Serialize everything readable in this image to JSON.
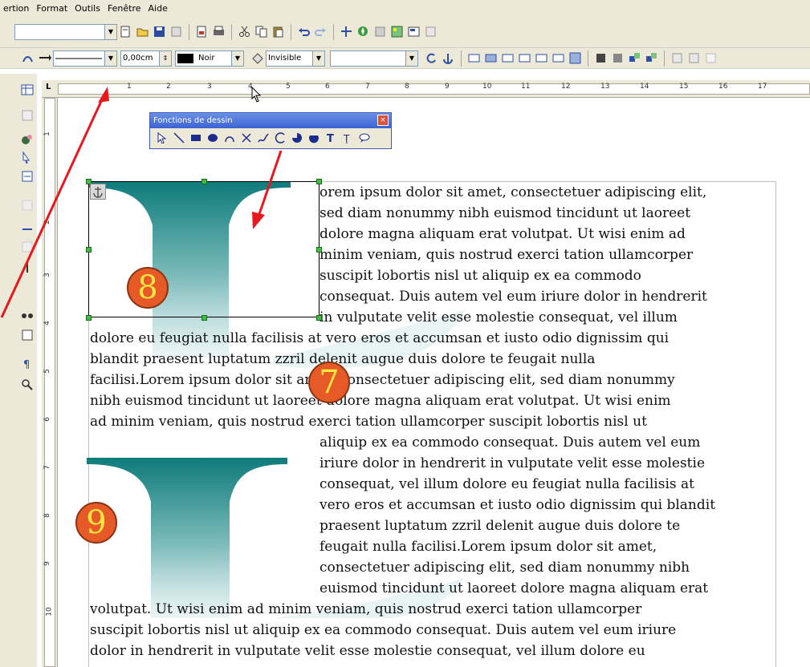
{
  "menubar": {
    "items": [
      "ertion",
      "Format",
      "Outils",
      "Fenêtre",
      "Aide"
    ]
  },
  "toolbar_line": {
    "width_value": "0,00cm",
    "color_label": "Noir",
    "area_label": "Invisible"
  },
  "palette": {
    "title": "Fonctions de dessin",
    "close_label": "×",
    "tools": [
      "select",
      "line",
      "rectangle",
      "ellipse",
      "curve",
      "polygon",
      "freeform",
      "arc",
      "pie",
      "circle-segment",
      "text",
      "vertical-text",
      "callout"
    ]
  },
  "ruler": {
    "h_ticks": [
      "1",
      "2",
      "3",
      "4",
      "5",
      "6",
      "7",
      "8",
      "9",
      "10",
      "11",
      "12",
      "13",
      "14",
      "15",
      "16",
      "17"
    ],
    "v_ticks": [
      "1",
      "2",
      "3",
      "4",
      "5",
      "6",
      "7",
      "8",
      "9",
      "10"
    ]
  },
  "document": {
    "lines_block1": [
      "orem ipsum dolor sit amet, consectetuer adipiscing elit,",
      "sed diam nonummy nibh euismod tincidunt ut laoreet",
      "dolore magna aliquam erat volutpat. Ut wisi enim ad",
      "minim veniam, quis nostrud exerci tation ullamcorper",
      "suscipit lobortis nisl ut aliquip ex ea commodo",
      "consequat. Duis autem vel eum iriure dolor in hendrerit",
      "in vulputate velit esse molestie consequat, vel illum"
    ],
    "lines_block2": [
      "dolore eu feugiat nulla facilisis at vero eros et accumsan et iusto odio dignissim qui",
      "blandit praesent luptatum zzril delenit augue duis dolore te feugait nulla",
      "facilisi.Lorem ipsum dolor sit amet, consectetuer adipiscing elit, sed diam nonummy",
      "nibh euismod tincidunt ut laoreet dolore magna aliquam erat volutpat. Ut wisi enim",
      "ad minim veniam, quis nostrud exerci tation ullamcorper suscipit lobortis nisl ut"
    ],
    "lines_block3": [
      "aliquip ex ea commodo consequat. Duis autem vel eum",
      "iriure dolor in hendrerit in vulputate velit esse molestie",
      "consequat, vel illum dolore eu feugiat nulla facilisis at",
      "vero eros et accumsan et iusto odio dignissim qui blandit",
      "praesent luptatum zzril delenit augue duis dolore te",
      "feugait nulla facilisi.Lorem ipsum dolor sit amet,",
      "consectetuer adipiscing elit, sed diam nonummy nibh",
      "euismod tincidunt ut laoreet dolore magna aliquam erat"
    ],
    "lines_block4": [
      "volutpat. Ut wisi enim ad minim veniam, quis nostrud exerci tation ullamcorper",
      "suscipit lobortis nisl ut aliquip ex ea commodo consequat. Duis autem vel eum iriure",
      "dolor in hendrerit in vulputate velit esse molestie consequat, vel illum dolore eu"
    ]
  },
  "badges": {
    "b7": "7",
    "b8": "8",
    "b9": "9"
  },
  "colors": {
    "teal": "#0e7b7b",
    "badge": "#e55a27",
    "badge_text": "#ffe640",
    "arrow": "#e8191e",
    "handle": "#3fbf3f"
  }
}
